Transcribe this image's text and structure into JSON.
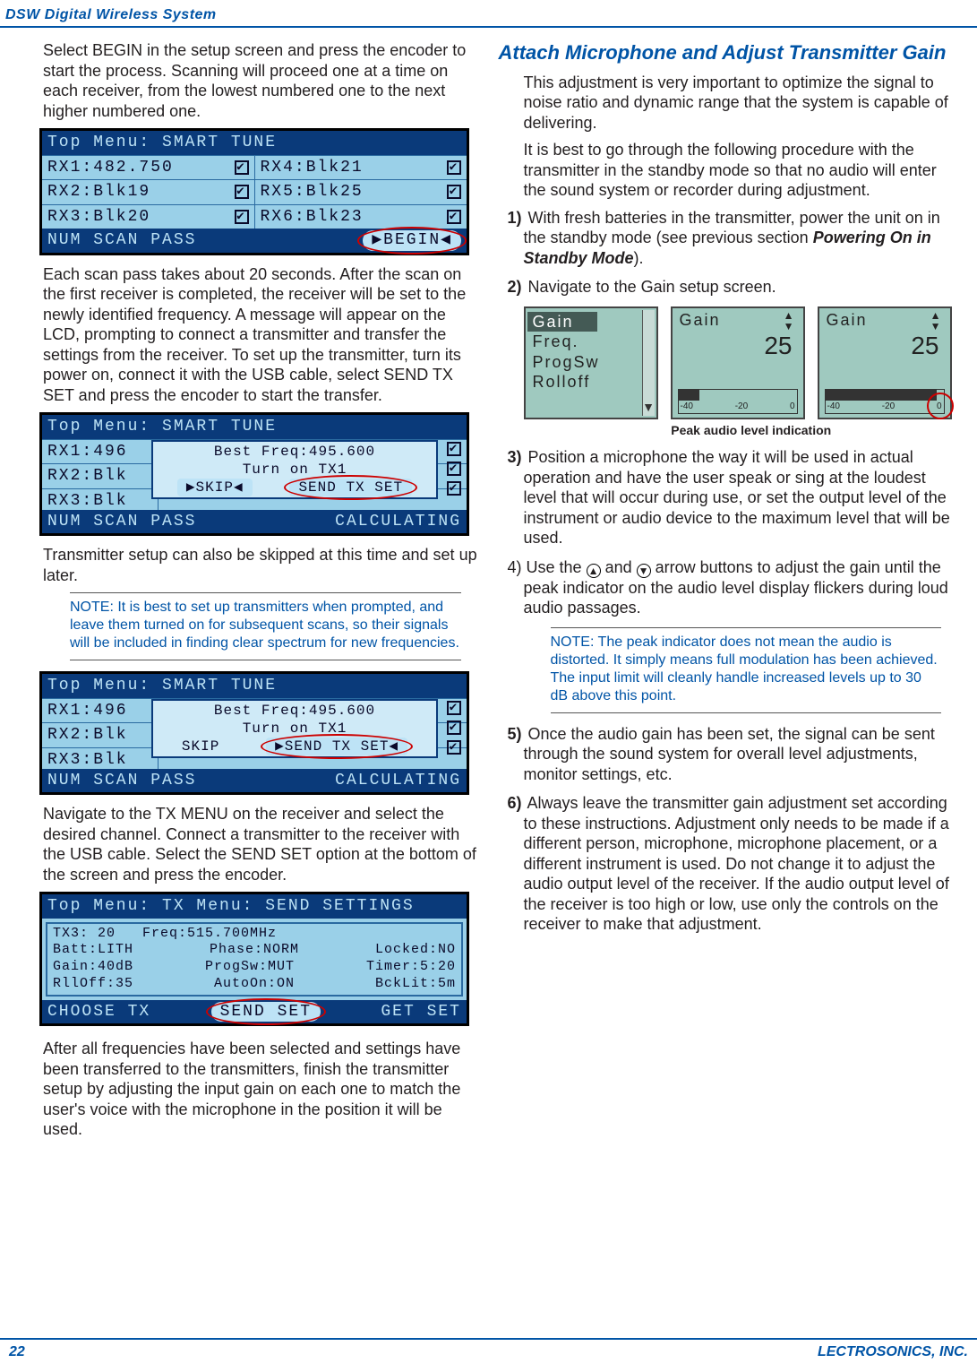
{
  "header": {
    "title": "DSW Digital Wireless System"
  },
  "footer": {
    "page": "22",
    "company": "LECTROSONICS, INC."
  },
  "left": {
    "p1": "Select BEGIN in the setup screen and press the encoder to start the process. Scanning will proceed one at a time on each receiver, from the lowest numbered one to the next higher numbered one.",
    "lcd1": {
      "title": "Top Menu: SMART TUNE",
      "rows": [
        [
          "RX1:482.750",
          "RX4:Blk21"
        ],
        [
          "RX2:Blk19",
          "RX5:Blk25"
        ],
        [
          "RX3:Blk20",
          "RX6:Blk23"
        ]
      ],
      "foot_left": "NUM SCAN PASS",
      "foot_right": "▶BEGIN◀"
    },
    "p2": "Each scan pass takes about 20 seconds. After the scan on the first receiver is completed, the receiver will be set to the newly identified frequency. A message will appear on the LCD, prompting to connect a transmitter and transfer the settings from the receiver. To set up the transmitter, turn its power on, connect it with the USB cable, select SEND TX SET and press the encoder to start the transfer.",
    "lcd2": {
      "title": "Top Menu: SMART TUNE",
      "rows_left": [
        "RX1:496",
        "RX2:Blk",
        "RX3:Blk"
      ],
      "overlay_l1": "Best Freq:495.600",
      "overlay_l2": "Turn on TX1",
      "overlay_b1": "▶SKIP◀",
      "overlay_b2": "SEND TX SET",
      "foot_left": "NUM SCAN PASS",
      "foot_right": "CALCULATING"
    },
    "p3": "Transmitter setup can also be skipped at this time and set up later.",
    "note1": "NOTE: It is best to set up transmitters when prompted, and leave them turned on for subsequent scans, so their signals will be included in finding clear spectrum for new frequencies.",
    "lcd3": {
      "title": "Top Menu: SMART TUNE",
      "rows_left": [
        "RX1:496",
        "RX2:Blk",
        "RX3:Blk"
      ],
      "overlay_l1": "Best Freq:495.600",
      "overlay_l2": "Turn on TX1",
      "overlay_b1": "SKIP",
      "overlay_b2": "▶SEND TX SET◀",
      "foot_left": "NUM SCAN PASS",
      "foot_right": "CALCULATING"
    },
    "p4": "Navigate to the TX MENU on the receiver and select the desired channel. Connect a transmitter to the receiver with the USB cable. Select the SEND SET option at the bottom of the screen and press the encoder.",
    "lcd4": {
      "title": "Top Menu: TX Menu: SEND SETTINGS",
      "l1a": "TX3: 20",
      "l1b": "Freq:515.700MHz",
      "l2a": "Batt:LITH",
      "l2b": "Phase:NORM",
      "l2c": "Locked:NO",
      "l3a": "Gain:40dB",
      "l3b": "ProgSw:MUT",
      "l3c": "Timer:5:20",
      "l4a": "RllOff:35",
      "l4b": "AutoOn:ON",
      "l4c": "BckLit:5m",
      "foot_left": "CHOOSE TX",
      "foot_mid": "SEND SET",
      "foot_right": "GET SET"
    },
    "p5": "After all frequencies have been selected and settings have been transferred to the transmitters, finish the transmitter setup by adjusting the input gain on each one to match the user's voice with the microphone in the position it will be used."
  },
  "right": {
    "heading": "Attach Microphone and Adjust Transmitter Gain",
    "p1": "This adjustment is very important to optimize the signal to noise ratio and dynamic range that the system is capable of delivering.",
    "p2": "It is best to go through the following procedure with the transmitter in the standby mode so that no audio will enter the sound system or recorder during adjustment.",
    "s1a": "1)",
    "s1b": " With fresh batteries in the transmitter, power the unit on in the standby mode (see previous section ",
    "s1c": "Powering On in Standby Mode",
    "s1d": ").",
    "s2a": "2)",
    "s2b": " Navigate to the Gain setup screen.",
    "gain": {
      "menu": [
        "Gain",
        "Freq.",
        "ProgSw",
        "Rolloff"
      ],
      "label": "Gain",
      "value": "25",
      "ticks": [
        "-40",
        "-20",
        "0"
      ]
    },
    "caption": "Peak audio level indication",
    "s3a": "3)",
    "s3b": " Position a microphone the way it will be used in actual operation and have the user speak or sing at the loudest level that will occur during use, or set the output level of the instrument or audio device to the maximum level that will be used.",
    "s4a": "4)",
    "s4b_pre": " Use the ",
    "s4b_mid": " and ",
    "s4b_post": " arrow buttons to adjust the gain until the peak indicator on the audio level display flickers during loud audio passages.",
    "note2": "NOTE: The peak indicator does not mean the audio is distorted. It simply means full modulation has been achieved. The input limit will cleanly handle increased levels up to 30 dB above this point.",
    "s5a": "5)",
    "s5b": " Once the audio gain has been set, the signal can be sent through the sound system for overall level adjustments, monitor settings, etc.",
    "s6a": "6)",
    "s6b": " Always leave the transmitter gain adjustment set according to these instructions. Adjustment only needs to be made if a different person, microphone, microphone placement, or a different instrument is used. Do not change it to adjust the audio output level of the receiver. If the audio output level of the receiver is too high or low, use only the controls on the receiver to make that adjustment."
  }
}
